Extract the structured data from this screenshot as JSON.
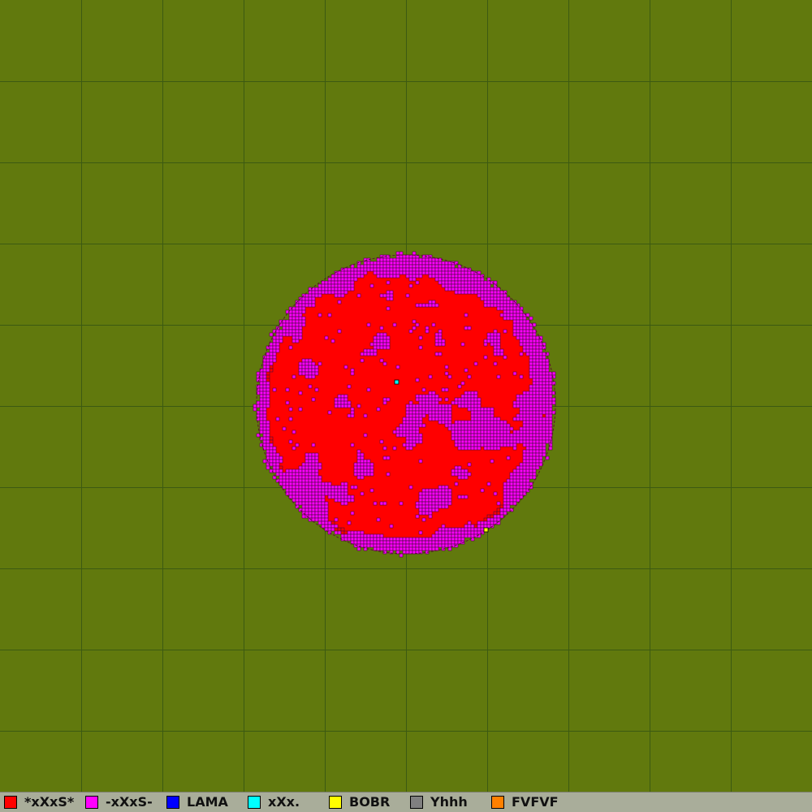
{
  "colors": {
    "terrain": "#61790d",
    "grid_line": "#3c5a12",
    "legend_bg": "#a9ad9a"
  },
  "territory": {
    "primary_player_color": "#ff0000",
    "secondary_player_color": "#ff00ff",
    "special_cells": [
      {
        "player": "xXx.",
        "color": "#00ffff"
      },
      {
        "player": "BOBR",
        "color": "#ffff00"
      }
    ]
  },
  "legend": {
    "players": [
      {
        "name": "*xXxS*",
        "color": "#ff0000"
      },
      {
        "name": "-xXxS-",
        "color": "#ff00ff"
      },
      {
        "name": "LAMA",
        "color": "#0000ff"
      },
      {
        "name": "xXx.",
        "color": "#00ffff"
      },
      {
        "name": "BOBR",
        "color": "#ffff00"
      },
      {
        "name": "Yhhh",
        "color": "#808080"
      },
      {
        "name": "FVFVF",
        "color": "#ff8000"
      }
    ]
  }
}
